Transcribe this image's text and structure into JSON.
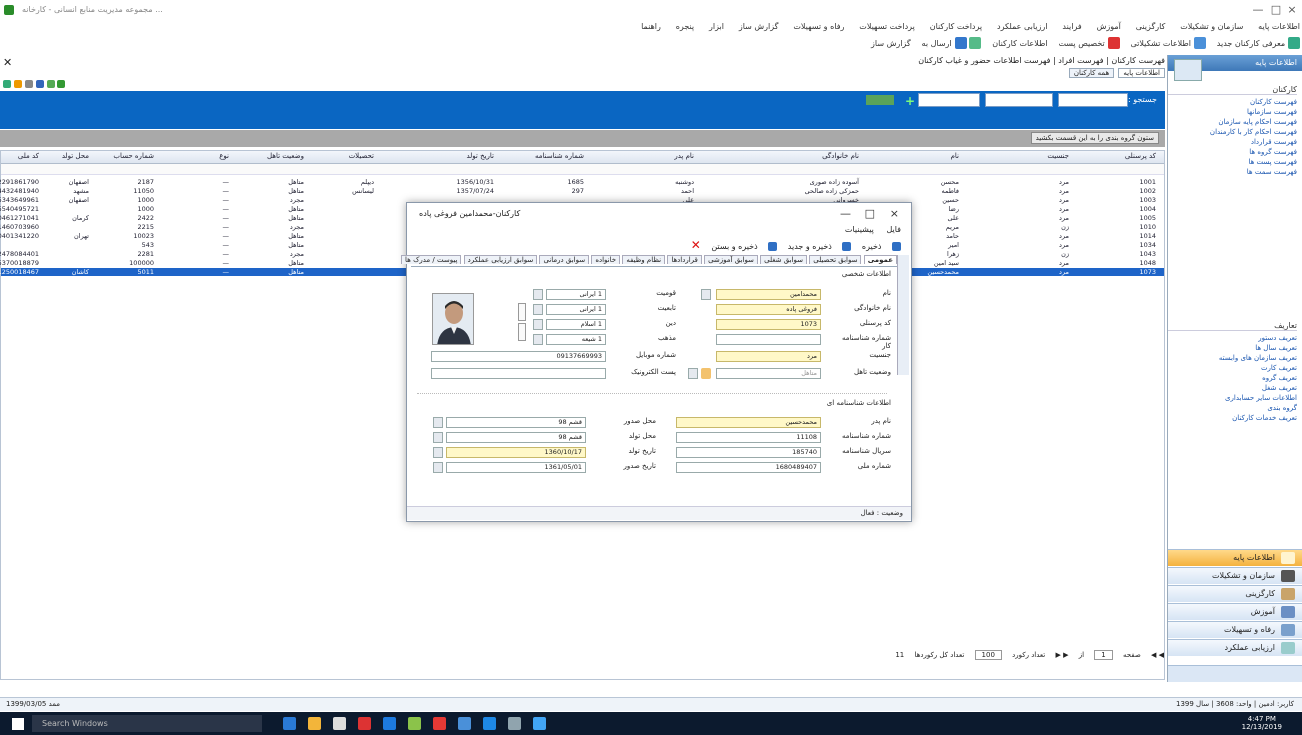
{
  "window": {
    "title": "مجموعه مدیریت منابع انسانی - کارخانه ... ",
    "controls": [
      "—",
      "□",
      "×"
    ]
  },
  "menu": [
    "اطلاعات پایه",
    "سازمان و تشکیلات",
    "کارگزینی",
    "آموزش",
    "فرایند",
    "ارزیابی عملکرد",
    "پرداخت کارکنان",
    "پرداخت تسهیلات",
    "رفاه و تسهیلات",
    "گزارش ساز",
    "ابزار",
    "پنجره",
    "راهنما"
  ],
  "toolbar": [
    "معرفی کارکنان جدید",
    "اطلاعات تشکیلاتی",
    "تخصیص پست",
    "اطلاعات کارکنان",
    "ارسال به",
    "گزارش ساز"
  ],
  "breadcrumb": "فهرست کارکنان  |  فهرست افراد  |  فهرست اطلاعات حضور و غیاب کارکنان",
  "subtabs": [
    "اطلاعات پایه",
    "همه کارکنان"
  ],
  "bluebar": {
    "label": "جستجو :"
  },
  "graybar": {
    "hint": "ستون گروه بندی را به این قسمت بکشید"
  },
  "grid": {
    "headers": [
      "کد پرسنلی",
      "جنسیت",
      "نام",
      "نام خانوادگی",
      "نام پدر",
      "شماره شناسنامه",
      "تاریخ تولد",
      "تحصیلات",
      "وضعیت تاهل",
      "نوع",
      "شماره حساب",
      "محل تولد",
      "کد ملی"
    ],
    "rows": [
      [
        "1001",
        "مرد",
        "محسن",
        "آسوده زاده صوری",
        "دوشنبه",
        "1685",
        "1356/10/31",
        "دیپلم",
        "متاهل",
        "—",
        "2187",
        "اصفهان",
        "2291861790"
      ],
      [
        "1002",
        "مرد",
        "فاطمه",
        "حمزکی زاده صالحی",
        "احمد",
        "297",
        "1357/07/24",
        "لیسانس",
        "متاهل",
        "—",
        "11050",
        "مشهد",
        "4432481940"
      ],
      [
        "1003",
        "مرد",
        "حسین",
        "خسروانی",
        "علی",
        "",
        "",
        "",
        "مجرد",
        "—",
        "1000",
        "اصفهان",
        "5343649961"
      ],
      [
        "1004",
        "مرد",
        "رضا",
        "محمدی",
        "",
        "",
        "",
        "",
        "متاهل",
        "—",
        "1000",
        "",
        "5540495721"
      ],
      [
        "1005",
        "مرد",
        "علی",
        "احمدی",
        "",
        "",
        "",
        "",
        "متاهل",
        "—",
        "2422",
        "کرمان",
        "0461271041"
      ],
      [
        "1010",
        "زن",
        "مریم",
        "کریمی",
        "",
        "",
        "",
        "",
        "مجرد",
        "—",
        "2215",
        "",
        "1460703960"
      ],
      [
        "1014",
        "مرد",
        "حامد",
        "رحیمی",
        "",
        "",
        "",
        "",
        "متاهل",
        "—",
        "10023",
        "تهران",
        "0401341220"
      ],
      [
        "1034",
        "مرد",
        "امیر",
        "رضایی",
        "",
        "",
        "",
        "",
        "متاهل",
        "—",
        "543",
        "",
        ""
      ],
      [
        "1043",
        "زن",
        "زهرا",
        "حسینی",
        "",
        "",
        "",
        "",
        "مجرد",
        "—",
        "2281",
        "",
        "2478084401"
      ],
      [
        "1048",
        "مرد",
        "سید امین",
        "موسوی",
        "",
        "",
        "",
        "",
        "متاهل",
        "—",
        "100000",
        "",
        "5370018879"
      ],
      [
        "1073",
        "مرد",
        "محمدحسین",
        "سعیدی",
        "",
        "",
        "",
        "",
        "متاهل",
        "—",
        "5011",
        "کاشان",
        "1250018467"
      ]
    ],
    "selected_row": 10
  },
  "pager": {
    "page_label": "صفحه",
    "page": "1",
    "of": "از",
    "count_label": "تعداد رکورد",
    "count": "100",
    "total_label": "تعداد کل رکوردها",
    "total": "11"
  },
  "status": {
    "left": "1399/03/05  ممد",
    "right": "کاربر: ادمین  |  واحد: 3608  |  سال 1399"
  },
  "taskbar": {
    "search": "Search Windows",
    "time": "4:47 PM",
    "date": "12/13/2019"
  },
  "nav": {
    "header": "اطلاعات پایه",
    "group1": {
      "title": "کارکنان",
      "items": [
        "فهرست کارکنان",
        "فهرست سازمانها",
        "فهرست احکام پایه سازمان",
        "فهرست احکام کار با کارمندان",
        "فهرست قرارداد",
        "فهرست گروه ها",
        "فهرست پست ها",
        "فهرست سمت ها"
      ]
    },
    "group2": {
      "title": "تعاریف",
      "items": [
        "تعریف دستور",
        "تعریف سال ها",
        "تعریف سازمان های وابسته",
        "تعریف کارت",
        "تعریف گروه",
        "تعریف شغل",
        "اطلاعات سایر حسابداری",
        "گروه بندی",
        "تعریف خدمات کارکنان"
      ]
    },
    "buttons": [
      "اطلاعات پایه",
      "سازمان و تشکیلات",
      "کارگزینی",
      "آموزش",
      "رفاه و تسهیلات",
      "ارزیابی عملکرد"
    ]
  },
  "dialog": {
    "title": "کارکنان-محمدامین فروغی پاده",
    "controls": [
      "—",
      "□",
      "×"
    ],
    "menu": [
      "فایل",
      "پیشینیات"
    ],
    "actions": [
      "ذخیره",
      "ذخیره و جدید",
      "ذخیره و بستن",
      "حذف"
    ],
    "tabs": [
      "عمومی",
      "سوابق تحصیلی",
      "سوابق شغلی",
      "سوابق آموزشی",
      "قراردادها",
      "نظام وظیفه",
      "خانواده",
      "سوابق درمانی",
      "سوابق ارزیابی عملکرد",
      "پیوست / مدرک ها"
    ],
    "section1": "اطلاعات شخصی",
    "section2": "اطلاعات شناسنامه ای",
    "fields_right": [
      {
        "label": "نام",
        "value": "محمدامین"
      },
      {
        "label": "نام خانوادگی",
        "value": "فروغی پاده"
      },
      {
        "label": "کد پرسنلی",
        "value": "1073"
      },
      {
        "label": "شماره شناسنامه کار",
        "value": ""
      },
      {
        "label": "جنسیت",
        "value": "مرد"
      },
      {
        "label": "وضعیت تاهل",
        "value": "متاهل"
      }
    ],
    "fields_mid": [
      {
        "label": "قومیت",
        "value": "1  ایرانی"
      },
      {
        "label": "تابعیت",
        "value": "1  ایرانی"
      },
      {
        "label": "دین",
        "value": "1  اسلام"
      },
      {
        "label": "مذهب",
        "value": "1  شیعه"
      },
      {
        "label": "شماره موبایل",
        "value": "09137669993"
      },
      {
        "label": "پست الکترونیک",
        "value": ""
      }
    ],
    "fields_id_right": [
      {
        "label": "نام پدر",
        "value": "محمدحسین"
      },
      {
        "label": "شماره شناسنامه",
        "value": "11108"
      },
      {
        "label": "سریال شناسنامه",
        "value": "185740"
      },
      {
        "label": "شماره ملی",
        "value": "1680489407"
      }
    ],
    "fields_id_mid": [
      {
        "label": "محل صدور",
        "value": "قشم  98"
      },
      {
        "label": "محل تولد",
        "value": "قشم  98"
      },
      {
        "label": "تاریخ تولد",
        "value": "1360/10/17"
      },
      {
        "label": "تاریخ صدور",
        "value": "1361/05/01"
      }
    ],
    "status": "وضعیت :  فعال"
  }
}
